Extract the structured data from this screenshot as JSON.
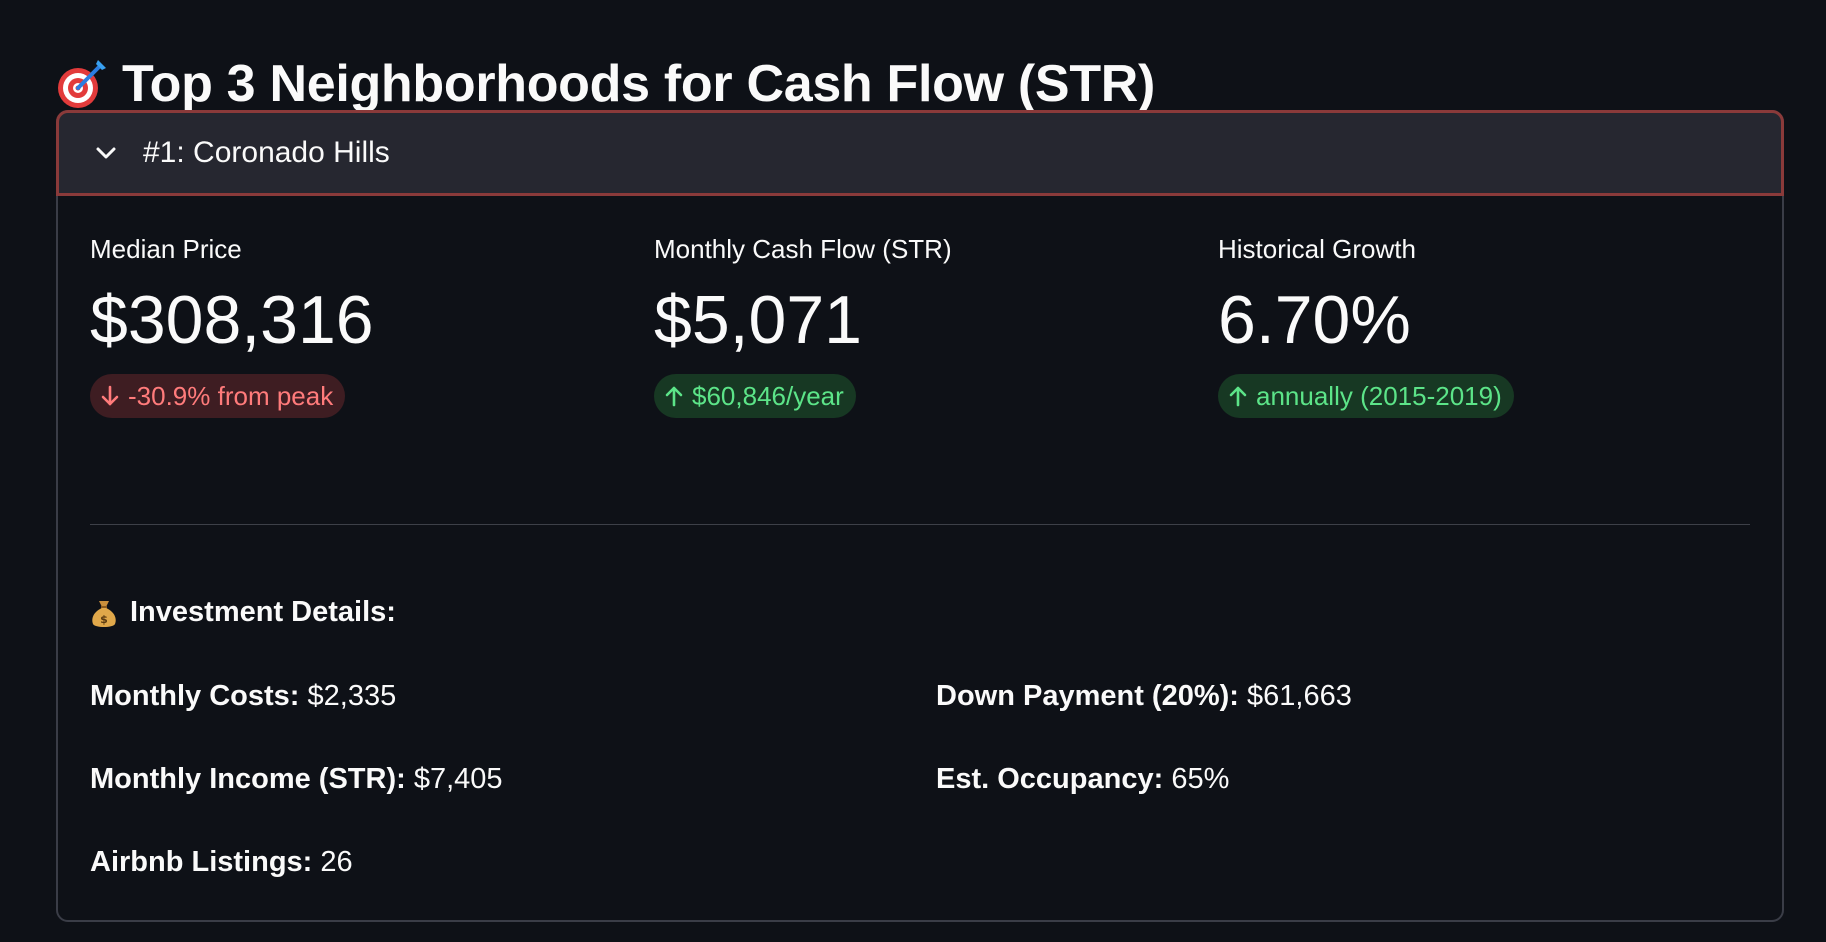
{
  "page": {
    "title": "Top 3 Neighborhoods for Cash Flow (STR)",
    "title_icon": "target-dart-icon"
  },
  "expander": {
    "title": "#1: Coronado Hills",
    "expanded": true,
    "chevron_icon": "chevron-down-icon"
  },
  "metrics": [
    {
      "label": "Median Price",
      "value": "$308,316",
      "delta": "-30.9% from peak",
      "direction": "down",
      "color": "#ff7b7b"
    },
    {
      "label": "Monthly Cash Flow (STR)",
      "value": "$5,071",
      "delta": "$60,846/year",
      "direction": "up",
      "color": "#5ce488"
    },
    {
      "label": "Historical Growth",
      "value": "6.70%",
      "delta": "annually (2015-2019)",
      "direction": "up",
      "color": "#5ce488"
    }
  ],
  "investment": {
    "heading": "Investment Details:",
    "heading_icon": "money-bag-icon",
    "monthly_costs_label": "Monthly Costs:",
    "monthly_costs_value": "$2,335",
    "monthly_income_label": "Monthly Income (STR):",
    "monthly_income_value": "$7,405",
    "airbnb_listings_label": "Airbnb Listings:",
    "airbnb_listings_value": "26",
    "down_payment_label": "Down Payment (20%):",
    "down_payment_value": "$61,663",
    "occupancy_label": "Est. Occupancy:",
    "occupancy_value": "65%"
  },
  "colors": {
    "background": "#0e1117",
    "header_background": "#262730",
    "header_border": "#8a3a3a",
    "negative": "#ff7b7b",
    "positive": "#5ce488"
  }
}
